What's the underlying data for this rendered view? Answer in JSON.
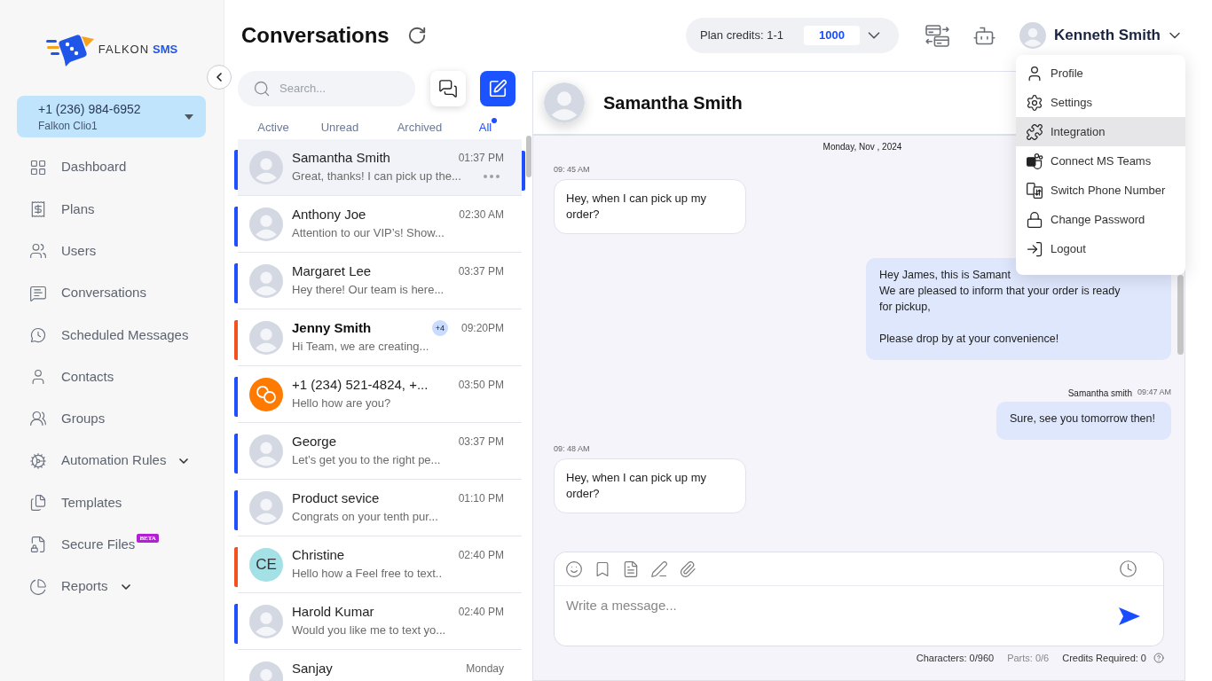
{
  "sidebar": {
    "logo": {
      "text": "FALKON",
      "accent": "SMS"
    },
    "phone_selector": {
      "number": "+1 (236) 984-6952",
      "name": "Falkon Clio1"
    },
    "nav": [
      {
        "label": "Dashboard",
        "selected": false,
        "expandable": false
      },
      {
        "label": "Plans",
        "selected": false,
        "expandable": false
      },
      {
        "label": "Users",
        "selected": false,
        "expandable": false
      },
      {
        "label": "Conversations",
        "selected": false,
        "expandable": false
      },
      {
        "label": "Scheduled Messages",
        "selected": false,
        "expandable": false
      },
      {
        "label": "Contacts",
        "selected": false,
        "expandable": false
      },
      {
        "label": "Groups",
        "selected": false,
        "expandable": false
      },
      {
        "label": "Automation Rules",
        "selected": false,
        "expandable": true
      },
      {
        "label": "Templates",
        "selected": false,
        "expandable": false
      },
      {
        "label": "Secure Files",
        "selected": false,
        "expandable": false,
        "badge": "BETA"
      },
      {
        "label": "Reports",
        "selected": false,
        "expandable": true
      }
    ]
  },
  "header": {
    "title": "Conversations",
    "plan_credits": {
      "label": "Plan credits: 1-1",
      "value": "1000"
    },
    "user": {
      "name": "Kenneth Smith",
      "menu_open": true,
      "menu": [
        {
          "label": "Profile",
          "highlighted": false
        },
        {
          "label": "Settings",
          "highlighted": false
        },
        {
          "label": "Integration",
          "highlighted": true
        },
        {
          "label": "Connect MS Teams",
          "highlighted": false
        },
        {
          "label": "Switch Phone Number",
          "highlighted": false
        },
        {
          "label": "Change Password",
          "highlighted": false
        },
        {
          "label": "Logout",
          "highlighted": false
        }
      ]
    }
  },
  "conversations": {
    "search": {
      "placeholder": "Search..."
    },
    "tabs": [
      {
        "label": "Active",
        "selected": false,
        "dot": false
      },
      {
        "label": "Unread",
        "selected": false,
        "dot": false
      },
      {
        "label": "Archived",
        "selected": false,
        "dot": false
      },
      {
        "label": "All",
        "selected": true,
        "dot": true
      }
    ],
    "items": [
      {
        "name": "Samantha Smith",
        "time": "01:37 PM",
        "preview": "Great, thanks! I can pick up the...",
        "selected": true,
        "unread": false,
        "color": "#1f4fff",
        "avatar": {
          "kind": "photo"
        }
      },
      {
        "name": "Anthony Joe",
        "time": "02:30 AM",
        "preview": "Attention to our VIP’s! Show...",
        "selected": false,
        "unread": false,
        "color": "#1f4fff",
        "avatar": {
          "kind": "photo"
        }
      },
      {
        "name": "Margaret Lee",
        "time": "03:37 PM",
        "preview": "Hey there! Our team is here...",
        "selected": false,
        "unread": false,
        "color": "#1f4fff",
        "avatar": {
          "kind": "photo"
        }
      },
      {
        "name": "Jenny Smith",
        "time": "09:20PM",
        "preview": "Hi Team, we are creating...",
        "selected": false,
        "unread": true,
        "badge": "+4",
        "color": "#f4511e",
        "avatar": {
          "kind": "photo"
        }
      },
      {
        "name": "+1 (234) 521-4824, +...",
        "time": "03:50 PM",
        "preview": "Hello how are you?",
        "selected": false,
        "unread": false,
        "color": "#1f4fff",
        "avatar": {
          "kind": "group"
        }
      },
      {
        "name": "George",
        "time": "03:37 PM",
        "preview": "Let’s get you to the right pe...",
        "selected": false,
        "unread": false,
        "color": "#1f4fff",
        "avatar": {
          "kind": "photo"
        }
      },
      {
        "name": "Product sevice",
        "time": "01:10 PM",
        "preview": "Congrats on your tenth pur...",
        "selected": false,
        "unread": false,
        "color": "#1f4fff",
        "avatar": {
          "kind": "photo"
        }
      },
      {
        "name": "Christine",
        "time": "02:40 PM",
        "preview": "Hello how a Feel free to text..",
        "selected": false,
        "unread": false,
        "color": "#f4511e",
        "avatar": {
          "kind": "initials",
          "text": "CE"
        }
      },
      {
        "name": "Harold Kumar",
        "time": "02:40 PM",
        "preview": "Would you like me to text yo...",
        "selected": false,
        "unread": false,
        "color": "#1f4fff",
        "avatar": {
          "kind": "photo"
        }
      },
      {
        "name": "Sanjay",
        "time": "Monday",
        "selected": false,
        "unread": false,
        "avatar": {
          "kind": "photo"
        }
      }
    ]
  },
  "chat": {
    "contact": {
      "name": "Samantha Smith"
    },
    "date": "Monday, Nov , 2024",
    "messages": [
      {
        "kind": "incoming",
        "time": "09: 45 AM",
        "text": "Hey, when I can pick up my order?"
      },
      {
        "kind": "outgoing",
        "text": "Hey James, this is Samant\nWe are pleased to inform that your order is ready\nfor pickup,\n\nPlease drop by at your convenience!"
      },
      {
        "kind": "outgoing",
        "sender": "Samantha smith",
        "time": "09:47 AM",
        "text": "Sure, see you tomorrow then!"
      },
      {
        "kind": "incoming",
        "time": "09: 48 AM",
        "text": "Hey, when I can pick up my order?"
      }
    ],
    "composer": {
      "placeholder": "Write a message...",
      "counters": [
        {
          "text": "Characters: 0/960",
          "muted": false
        },
        {
          "text": "Parts: 0/6",
          "muted": true
        },
        {
          "text": "Credits Required: 0",
          "muted": false
        }
      ]
    }
  }
}
